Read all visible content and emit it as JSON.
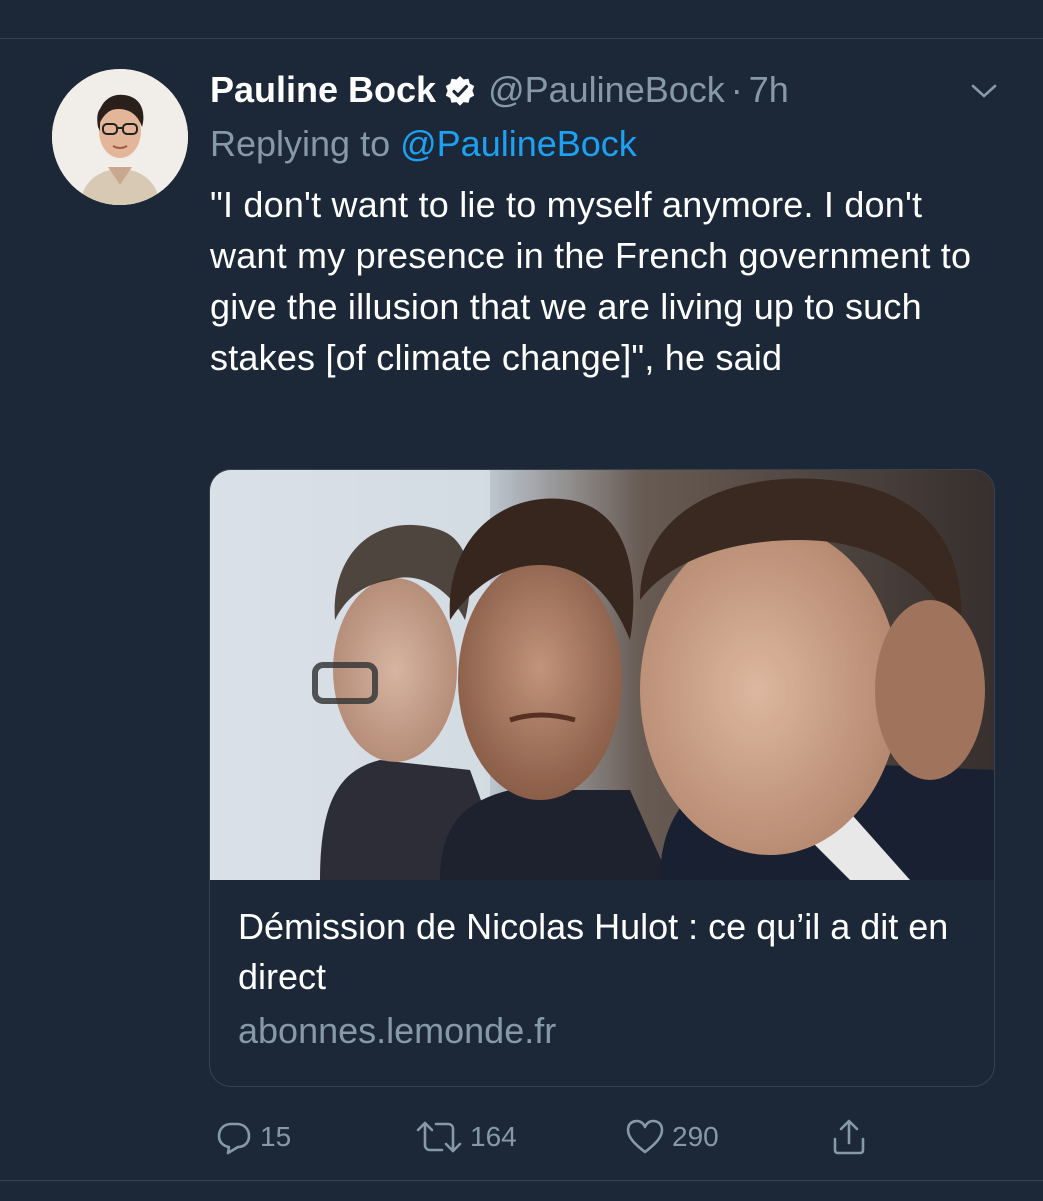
{
  "tweet": {
    "author_name": "Pauline Bock",
    "handle": "@PaulineBock",
    "separator": "·",
    "time": "7h",
    "replying_prefix": "Replying to",
    "replying_to": "@PaulineBock",
    "text": "\"I don't want to lie to myself anymore. I don't want my presence in the French government to give the illusion that we are living up to such stakes [of climate change]\", he said",
    "verified": true
  },
  "card": {
    "title": "Démission de Nicolas Hulot : ce qu’il a dit en direct",
    "domain": "abonnes.lemonde.fr"
  },
  "actions": {
    "replies": "15",
    "retweets": "164",
    "likes": "290"
  },
  "icons": {
    "verified": "verified-badge-icon",
    "caret": "chevron-down-icon",
    "reply": "reply-icon",
    "retweet": "retweet-icon",
    "like": "heart-icon",
    "share": "share-icon"
  },
  "colors": {
    "background": "#1c2838",
    "link": "#1da1f2",
    "muted": "#8899a6",
    "border": "#38444d"
  }
}
